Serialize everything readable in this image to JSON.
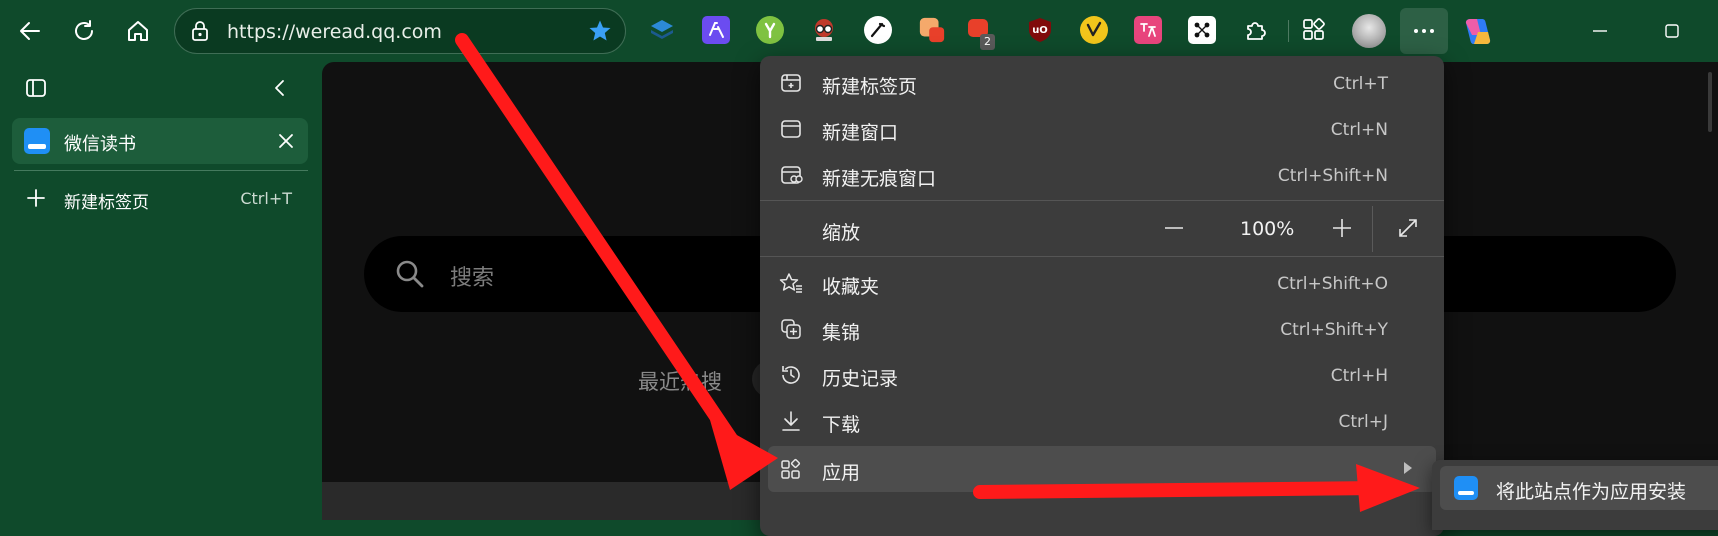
{
  "browser": {
    "address_bar": {
      "url": "https://weread.qq.com"
    },
    "extension_badge": "2"
  },
  "sidebar": {
    "active_tab": {
      "label": "微信读书"
    },
    "new_tab": {
      "label": "新建标签页",
      "shortcut": "Ctrl+T"
    }
  },
  "content": {
    "search_placeholder": "搜索",
    "recent_label": "最近热搜"
  },
  "menu": {
    "items": [
      {
        "label": "新建标签页",
        "shortcut": "Ctrl+T",
        "icon": "new-tab-icon"
      },
      {
        "label": "新建窗口",
        "shortcut": "Ctrl+N",
        "icon": "new-window-icon"
      },
      {
        "label": "新建无痕窗口",
        "shortcut": "Ctrl+Shift+N",
        "icon": "inprivate-icon"
      }
    ],
    "zoom": {
      "label": "缩放",
      "value": "100%",
      "minus": "—",
      "plus": "+"
    },
    "items2": [
      {
        "label": "收藏夹",
        "shortcut": "Ctrl+Shift+O",
        "icon": "favorites-icon"
      },
      {
        "label": "集锦",
        "shortcut": "Ctrl+Shift+Y",
        "icon": "collections-icon"
      },
      {
        "label": "历史记录",
        "shortcut": "Ctrl+H",
        "icon": "history-icon"
      },
      {
        "label": "下载",
        "shortcut": "Ctrl+J",
        "icon": "download-icon"
      },
      {
        "label": "应用",
        "shortcut": "",
        "icon": "apps-icon"
      }
    ]
  },
  "submenu": {
    "install_label": "将此站点作为应用安装"
  },
  "colors": {
    "toolbar_bg": "#0f4a2b",
    "menu_bg": "#3c3c3c",
    "accent_blue": "#1f8ff5",
    "annotation_red": "#ff1a1a"
  }
}
